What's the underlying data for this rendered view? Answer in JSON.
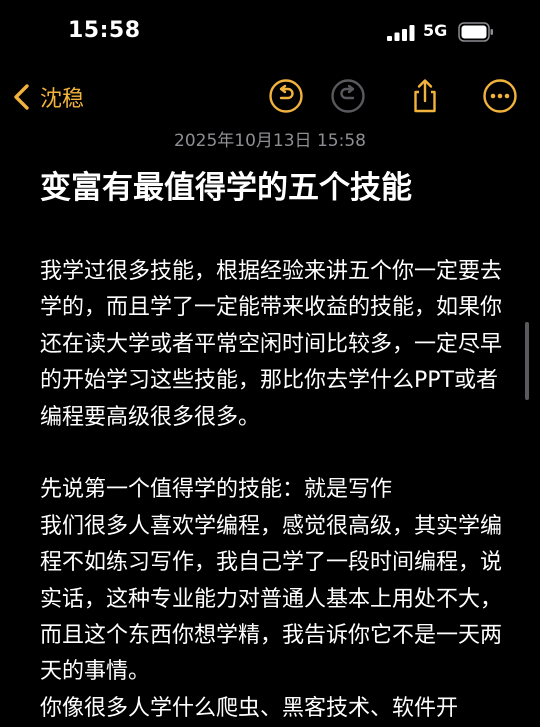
{
  "status_bar": {
    "time": "15:58",
    "network": "5G"
  },
  "nav": {
    "back_label": "沈稳",
    "accent_color": "#f2b33d"
  },
  "note": {
    "date": "2025年10月13日 15:58",
    "title": "变富有最值得学的五个技能",
    "paragraphs": [
      "我学过很多技能，根据经验来讲五个你一定要去学的，而且学了一定能带来收益的技能，如果你还在读大学或者平常空闲时间比较多，一定尽早的开始学习这些技能，那比你去学什么PPT或者编程要高级很多很多。",
      "",
      "先说第一个值得学的技能：就是写作",
      "我们很多人喜欢学编程，感觉很高级，其实学编程不如练习写作，我自己学了一段时间编程，说实话，这种专业能力对普通人基本上用处不大，而且这个东西你想学精，我告诉你它不是一天两天的事情。",
      "你像很多人学什么爬虫、黑客技术、软件开"
    ]
  }
}
